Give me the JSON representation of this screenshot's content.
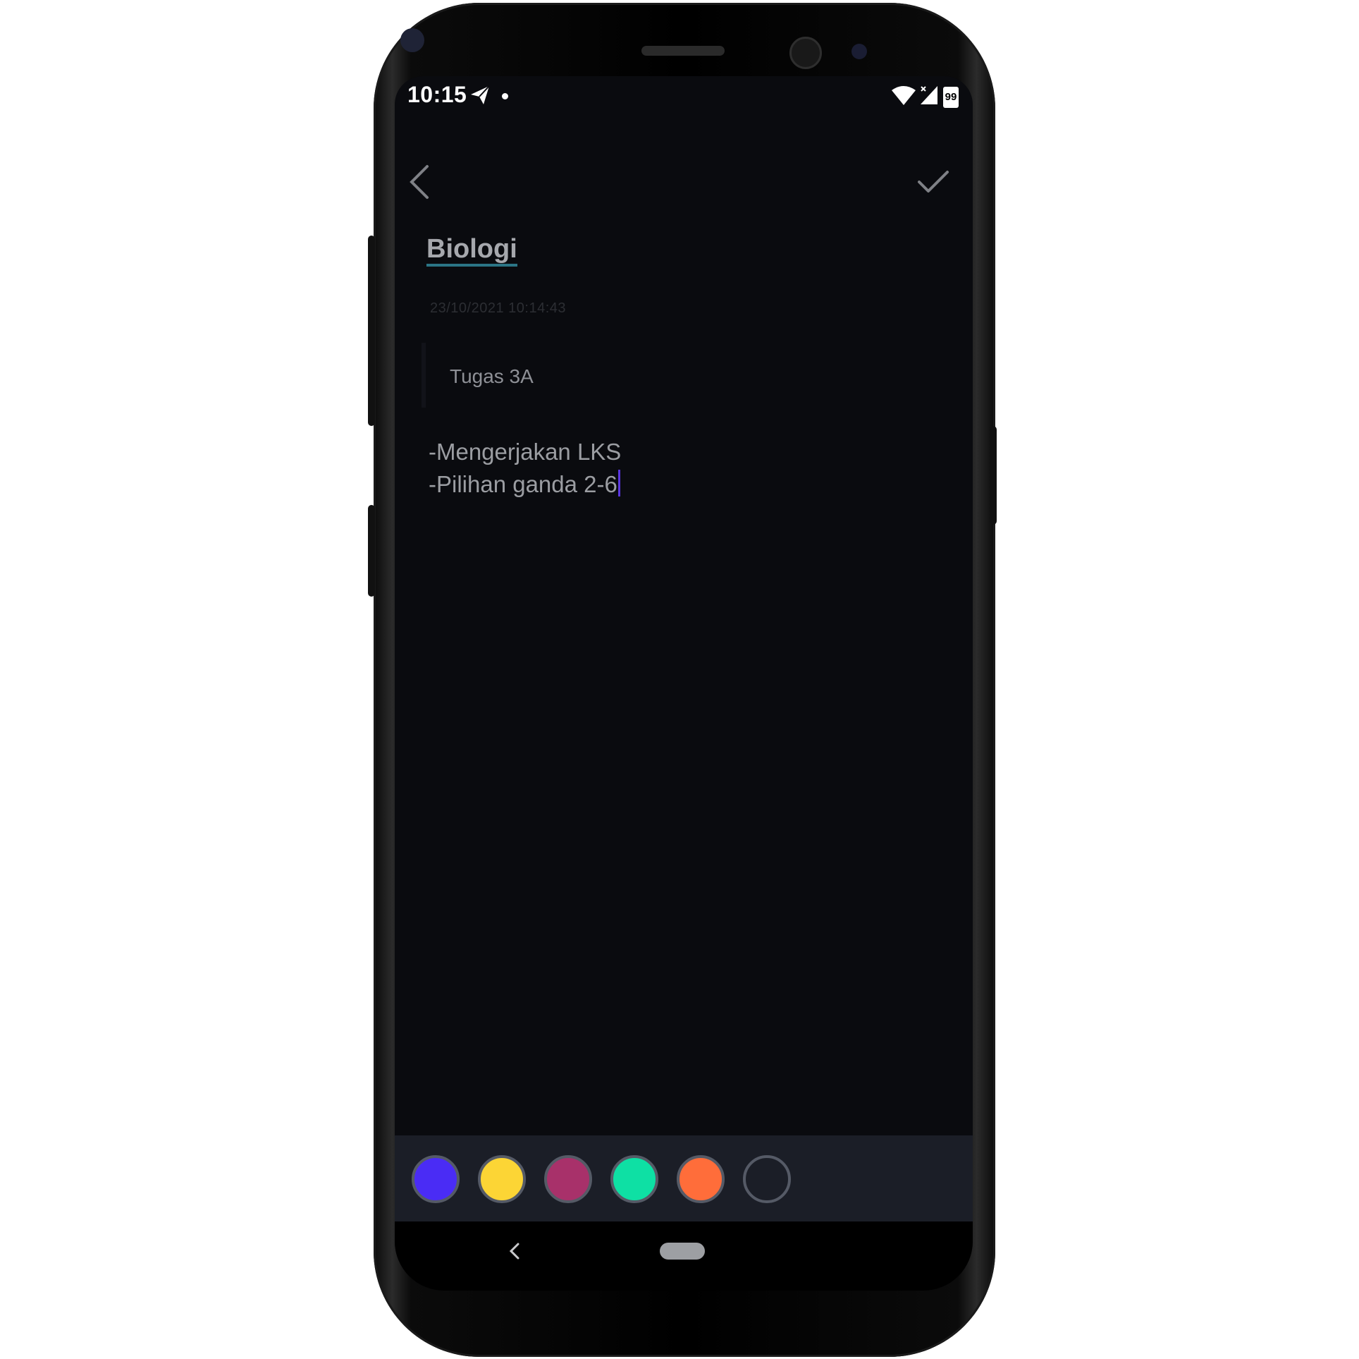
{
  "status_bar": {
    "time": "10:15",
    "battery": "99",
    "icons": [
      "telegram-send-icon",
      "notification-dot-icon",
      "wifi-icon",
      "signal-icon",
      "battery-icon"
    ]
  },
  "toolbar": {
    "back_icon": "chevron-left-icon",
    "save_icon": "checkmark-icon"
  },
  "note": {
    "title": "Biologi",
    "date": "23/10/2021 10:14:43",
    "tag": "Tugas 3A",
    "lines": [
      "-Mengerjakan LKS",
      "-Pilihan ganda 2-6"
    ]
  },
  "palette": {
    "colors": [
      "#4a2cf5",
      "#fcd535",
      "#a8316a",
      "#0ee0a4",
      "#ff6d3a",
      "#1b1e27"
    ]
  },
  "nav": {
    "back_icon": "nav-back-icon",
    "home_icon": "home-pill-icon"
  }
}
